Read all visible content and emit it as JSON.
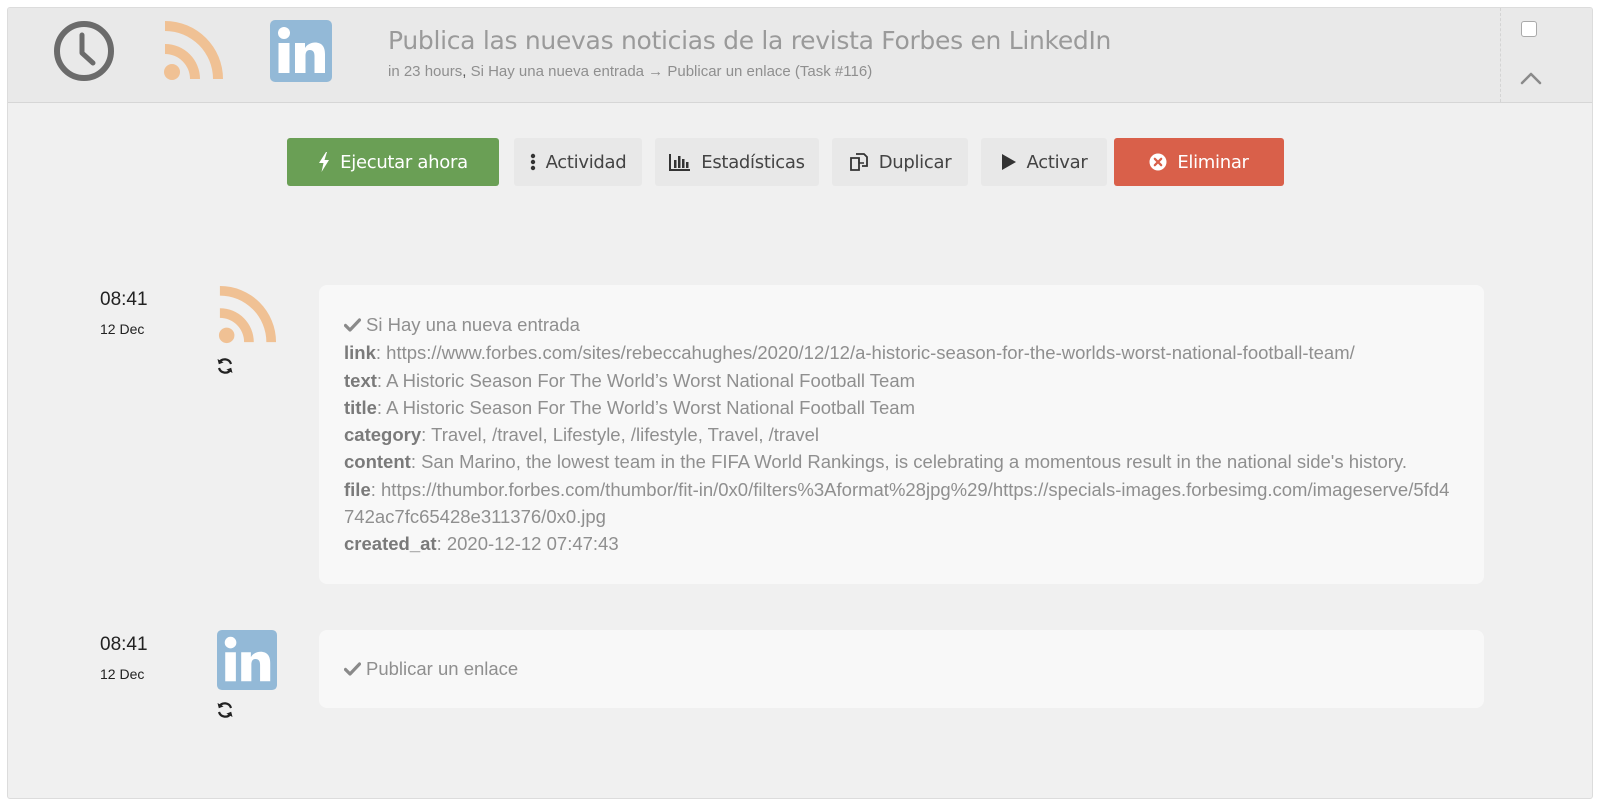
{
  "header": {
    "title": "Publica las nuevas noticias de la revista Forbes en LinkedIn",
    "schedule": "in 23 hours",
    "separator": ",",
    "flow": "Si Hay una nueva entrada → Publicar un enlace (Task #116)"
  },
  "toolbar": {
    "run_label": "Ejecutar ahora",
    "activity_label": "Actividad",
    "stats_label": "Estadísticas",
    "duplicate_label": "Duplicar",
    "activate_label": "Activar",
    "delete_label": "Eliminar"
  },
  "entries": [
    {
      "time": "08:41",
      "date": "12 Dec",
      "icon": "rss-icon",
      "status": "Si Hay una nueva entrada",
      "fields": [
        {
          "key": "link",
          "value": "https://www.forbes.com/sites/rebeccahughes/2020/12/12/a-historic-season-for-the-worlds-worst-national-football-team/"
        },
        {
          "key": "text",
          "value": "A Historic Season For The World’s Worst National Football Team"
        },
        {
          "key": "title",
          "value": "A Historic Season For The World’s Worst National Football Team"
        },
        {
          "key": "category",
          "value": "Travel, /travel, Lifestyle, /lifestyle, Travel, /travel"
        },
        {
          "key": "content",
          "value": "San Marino, the lowest team in the FIFA World Rankings, is celebrating a momentous result in the national side's history."
        },
        {
          "key": "file",
          "value": "https://thumbor.forbes.com/thumbor/fit-in/0x0/filters%3Aformat%28jpg%29/https://specials-images.forbesimg.com/imageserve/5fd4742ac7fc65428e311376/0x0.jpg"
        },
        {
          "key": "created_at",
          "value": "2020-12-12 07:47:43"
        }
      ]
    },
    {
      "time": "08:41",
      "date": "12 Dec",
      "icon": "linkedin-icon",
      "status": "Publicar un enlace"
    }
  ],
  "colors": {
    "run": "#6a9f55",
    "delete": "#d9604a",
    "rss": "#f0c194",
    "linkedin": "#93b9d7",
    "clock": "#6b6b6b"
  }
}
